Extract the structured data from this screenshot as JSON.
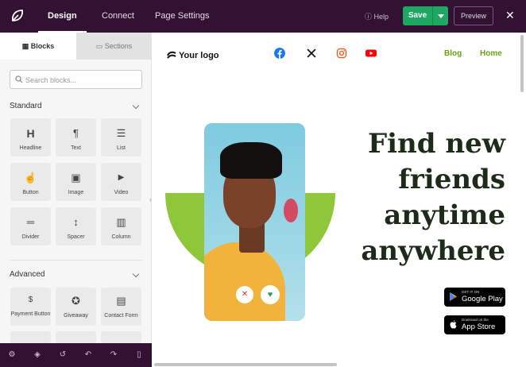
{
  "topbar": {
    "tabs": [
      {
        "label": "Design",
        "active": true
      },
      {
        "label": "Connect",
        "active": false
      },
      {
        "label": "Page Settings",
        "active": false
      }
    ],
    "help_label": "Help",
    "save_label": "Save",
    "preview_label": "Preview",
    "close_glyph": "✕"
  },
  "sidebar": {
    "tabs": {
      "blocks": "Blocks",
      "sections": "Sections"
    },
    "search_placeholder": "Search blocks...",
    "standard": {
      "title": "Standard",
      "blocks": [
        {
          "label": "Headline",
          "icon": "H"
        },
        {
          "label": "Text",
          "icon": "¶"
        },
        {
          "label": "List",
          "icon": "☰"
        },
        {
          "label": "Button",
          "icon": "☝"
        },
        {
          "label": "Image",
          "icon": "▣"
        },
        {
          "label": "Video",
          "icon": "▶"
        },
        {
          "label": "Divider",
          "icon": "═"
        },
        {
          "label": "Spacer",
          "icon": "↕"
        },
        {
          "label": "Column",
          "icon": "▥"
        }
      ]
    },
    "advanced": {
      "title": "Advanced",
      "blocks": [
        {
          "label": "Payment Button",
          "icon": "$"
        },
        {
          "label": "Giveaway",
          "icon": "✪"
        },
        {
          "label": "Contact Form",
          "icon": "▤"
        }
      ]
    },
    "bottom_icons": [
      "gear-icon",
      "layers-icon",
      "history-icon",
      "undo-icon",
      "redo-icon",
      "mobile-preview-icon"
    ]
  },
  "canvas": {
    "logo_text": "Your logo",
    "social": [
      "facebook-icon",
      "x-icon",
      "instagram-icon",
      "youtube-icon"
    ],
    "nav": [
      "Blog",
      "Home"
    ],
    "headline_lines": [
      "Find new",
      "friends",
      "anytime",
      "anywhere"
    ],
    "google_play": {
      "small": "GET IT ON",
      "big": "Google Play"
    },
    "app_store": {
      "small": "Download on the",
      "big": "App Store"
    },
    "accent_color": "#6aa411"
  },
  "colors": {
    "topbar": "#321132",
    "save": "#1ea861",
    "blob": "#8ec83a"
  }
}
